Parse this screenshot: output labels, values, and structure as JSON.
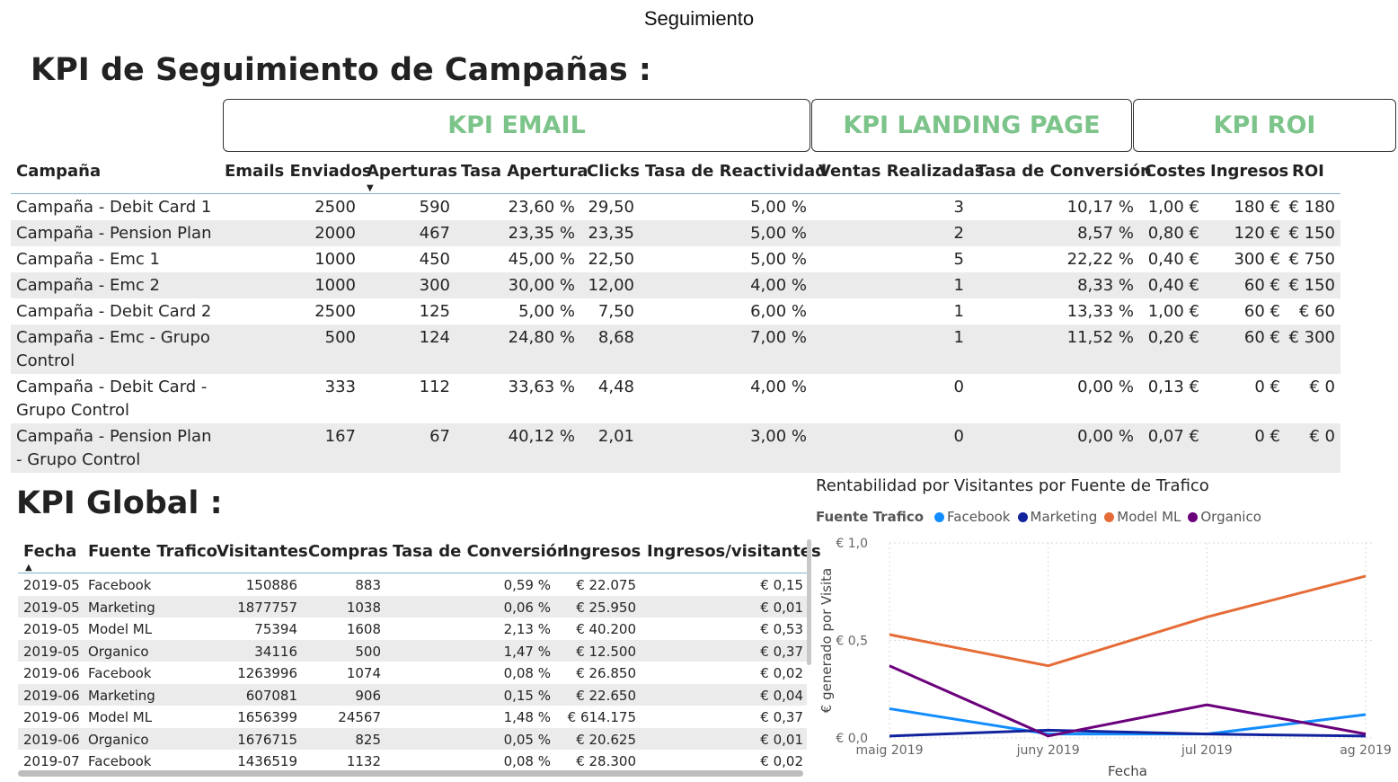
{
  "report": {
    "title": "Seguimiento"
  },
  "kpi_campaigns": {
    "title": "KPI de Seguimiento de Campañas :",
    "boxes": {
      "email": "KPI EMAIL",
      "landing": "KPI LANDING PAGE",
      "roi": "KPI ROI"
    },
    "headers": [
      "Campaña",
      "Emails Enviados",
      "Aperturas",
      "Tasa Apertura",
      "Clicks",
      "Tasa de Reactividad",
      "Ventas Realizadas",
      "Tasa de Conversión",
      "Costes",
      "Ingresos",
      "ROI"
    ],
    "rows": [
      [
        "Campaña - Debit Card 1",
        "2500",
        "590",
        "23,60 %",
        "29,50",
        "5,00 %",
        "3",
        "10,17 %",
        "1,00 €",
        "180 €",
        "€ 180"
      ],
      [
        "Campaña - Pension Plan",
        "2000",
        "467",
        "23,35 %",
        "23,35",
        "5,00 %",
        "2",
        "8,57 %",
        "0,80 €",
        "120 €",
        "€ 150"
      ],
      [
        "Campaña - Emc 1",
        "1000",
        "450",
        "45,00 %",
        "22,50",
        "5,00 %",
        "5",
        "22,22 %",
        "0,40 €",
        "300 €",
        "€ 750"
      ],
      [
        "Campaña - Emc 2",
        "1000",
        "300",
        "30,00 %",
        "12,00",
        "4,00 %",
        "1",
        "8,33 %",
        "0,40 €",
        "60 €",
        "€ 150"
      ],
      [
        "Campaña - Debit Card 2",
        "2500",
        "125",
        "5,00 %",
        "7,50",
        "6,00 %",
        "1",
        "13,33 %",
        "1,00 €",
        "60 €",
        "€ 60"
      ],
      [
        "Campaña - Emc - Grupo Control",
        "500",
        "124",
        "24,80 %",
        "8,68",
        "7,00 %",
        "1",
        "11,52 %",
        "0,20 €",
        "60 €",
        "€ 300"
      ],
      [
        "Campaña - Debit Card - Grupo Control",
        "333",
        "112",
        "33,63 %",
        "4,48",
        "4,00 %",
        "0",
        "0,00 %",
        "0,13 €",
        "0 €",
        "€ 0"
      ],
      [
        "Campaña - Pension Plan - Grupo Control",
        "167",
        "67",
        "40,12 %",
        "2,01",
        "3,00 %",
        "0",
        "0,00 %",
        "0,07 €",
        "0 €",
        "€ 0"
      ]
    ]
  },
  "kpi_global": {
    "title": "KPI Global :",
    "headers": [
      "Fecha",
      "Fuente Trafico",
      "Visitantes",
      "Compras",
      "Tasa de Conversión",
      "Ingresos",
      "Ingresos/visitantes"
    ],
    "rows": [
      [
        "2019-05",
        "Facebook",
        "150886",
        "883",
        "0,59 %",
        "€ 22.075",
        "€ 0,15"
      ],
      [
        "2019-05",
        "Marketing",
        "1877757",
        "1038",
        "0,06 %",
        "€ 25.950",
        "€ 0,01"
      ],
      [
        "2019-05",
        "Model ML",
        "75394",
        "1608",
        "2,13 %",
        "€ 40.200",
        "€ 0,53"
      ],
      [
        "2019-05",
        "Organico",
        "34116",
        "500",
        "1,47 %",
        "€ 12.500",
        "€ 0,37"
      ],
      [
        "2019-06",
        "Facebook",
        "1263996",
        "1074",
        "0,08 %",
        "€ 26.850",
        "€ 0,02"
      ],
      [
        "2019-06",
        "Marketing",
        "607081",
        "906",
        "0,15 %",
        "€ 22.650",
        "€ 0,04"
      ],
      [
        "2019-06",
        "Model ML",
        "1656399",
        "24567",
        "1,48 %",
        "€ 614.175",
        "€ 0,37"
      ],
      [
        "2019-06",
        "Organico",
        "1676715",
        "825",
        "0,05 %",
        "€ 20.625",
        "€ 0,01"
      ],
      [
        "2019-07",
        "Facebook",
        "1436519",
        "1132",
        "0,08 %",
        "€ 28.300",
        "€ 0,02"
      ]
    ]
  },
  "chart_data": {
    "type": "line",
    "title": "Rentabilidad por Visitantes por Fuente de Trafico",
    "legend_title": "Fuente Trafico",
    "xlabel": "Fecha",
    "ylabel": "€ generado por Visita",
    "categories": [
      "maig 2019",
      "juny 2019",
      "jul 2019",
      "ag 2019"
    ],
    "yticks": [
      "€ 0,0",
      "€ 0,5",
      "€ 1,0"
    ],
    "ylim": [
      0,
      1.0
    ],
    "grid": true,
    "legend_position": "top-left",
    "series": [
      {
        "name": "Facebook",
        "color": "#118DFF",
        "values": [
          0.15,
          0.02,
          0.02,
          0.12
        ]
      },
      {
        "name": "Marketing",
        "color": "#12239E",
        "values": [
          0.01,
          0.04,
          0.02,
          0.01
        ]
      },
      {
        "name": "Model ML",
        "color": "#E66C37",
        "values": [
          0.53,
          0.37,
          0.62,
          0.83
        ]
      },
      {
        "name": "Organico",
        "color": "#6B007B",
        "values": [
          0.37,
          0.01,
          0.17,
          0.02
        ]
      }
    ]
  }
}
